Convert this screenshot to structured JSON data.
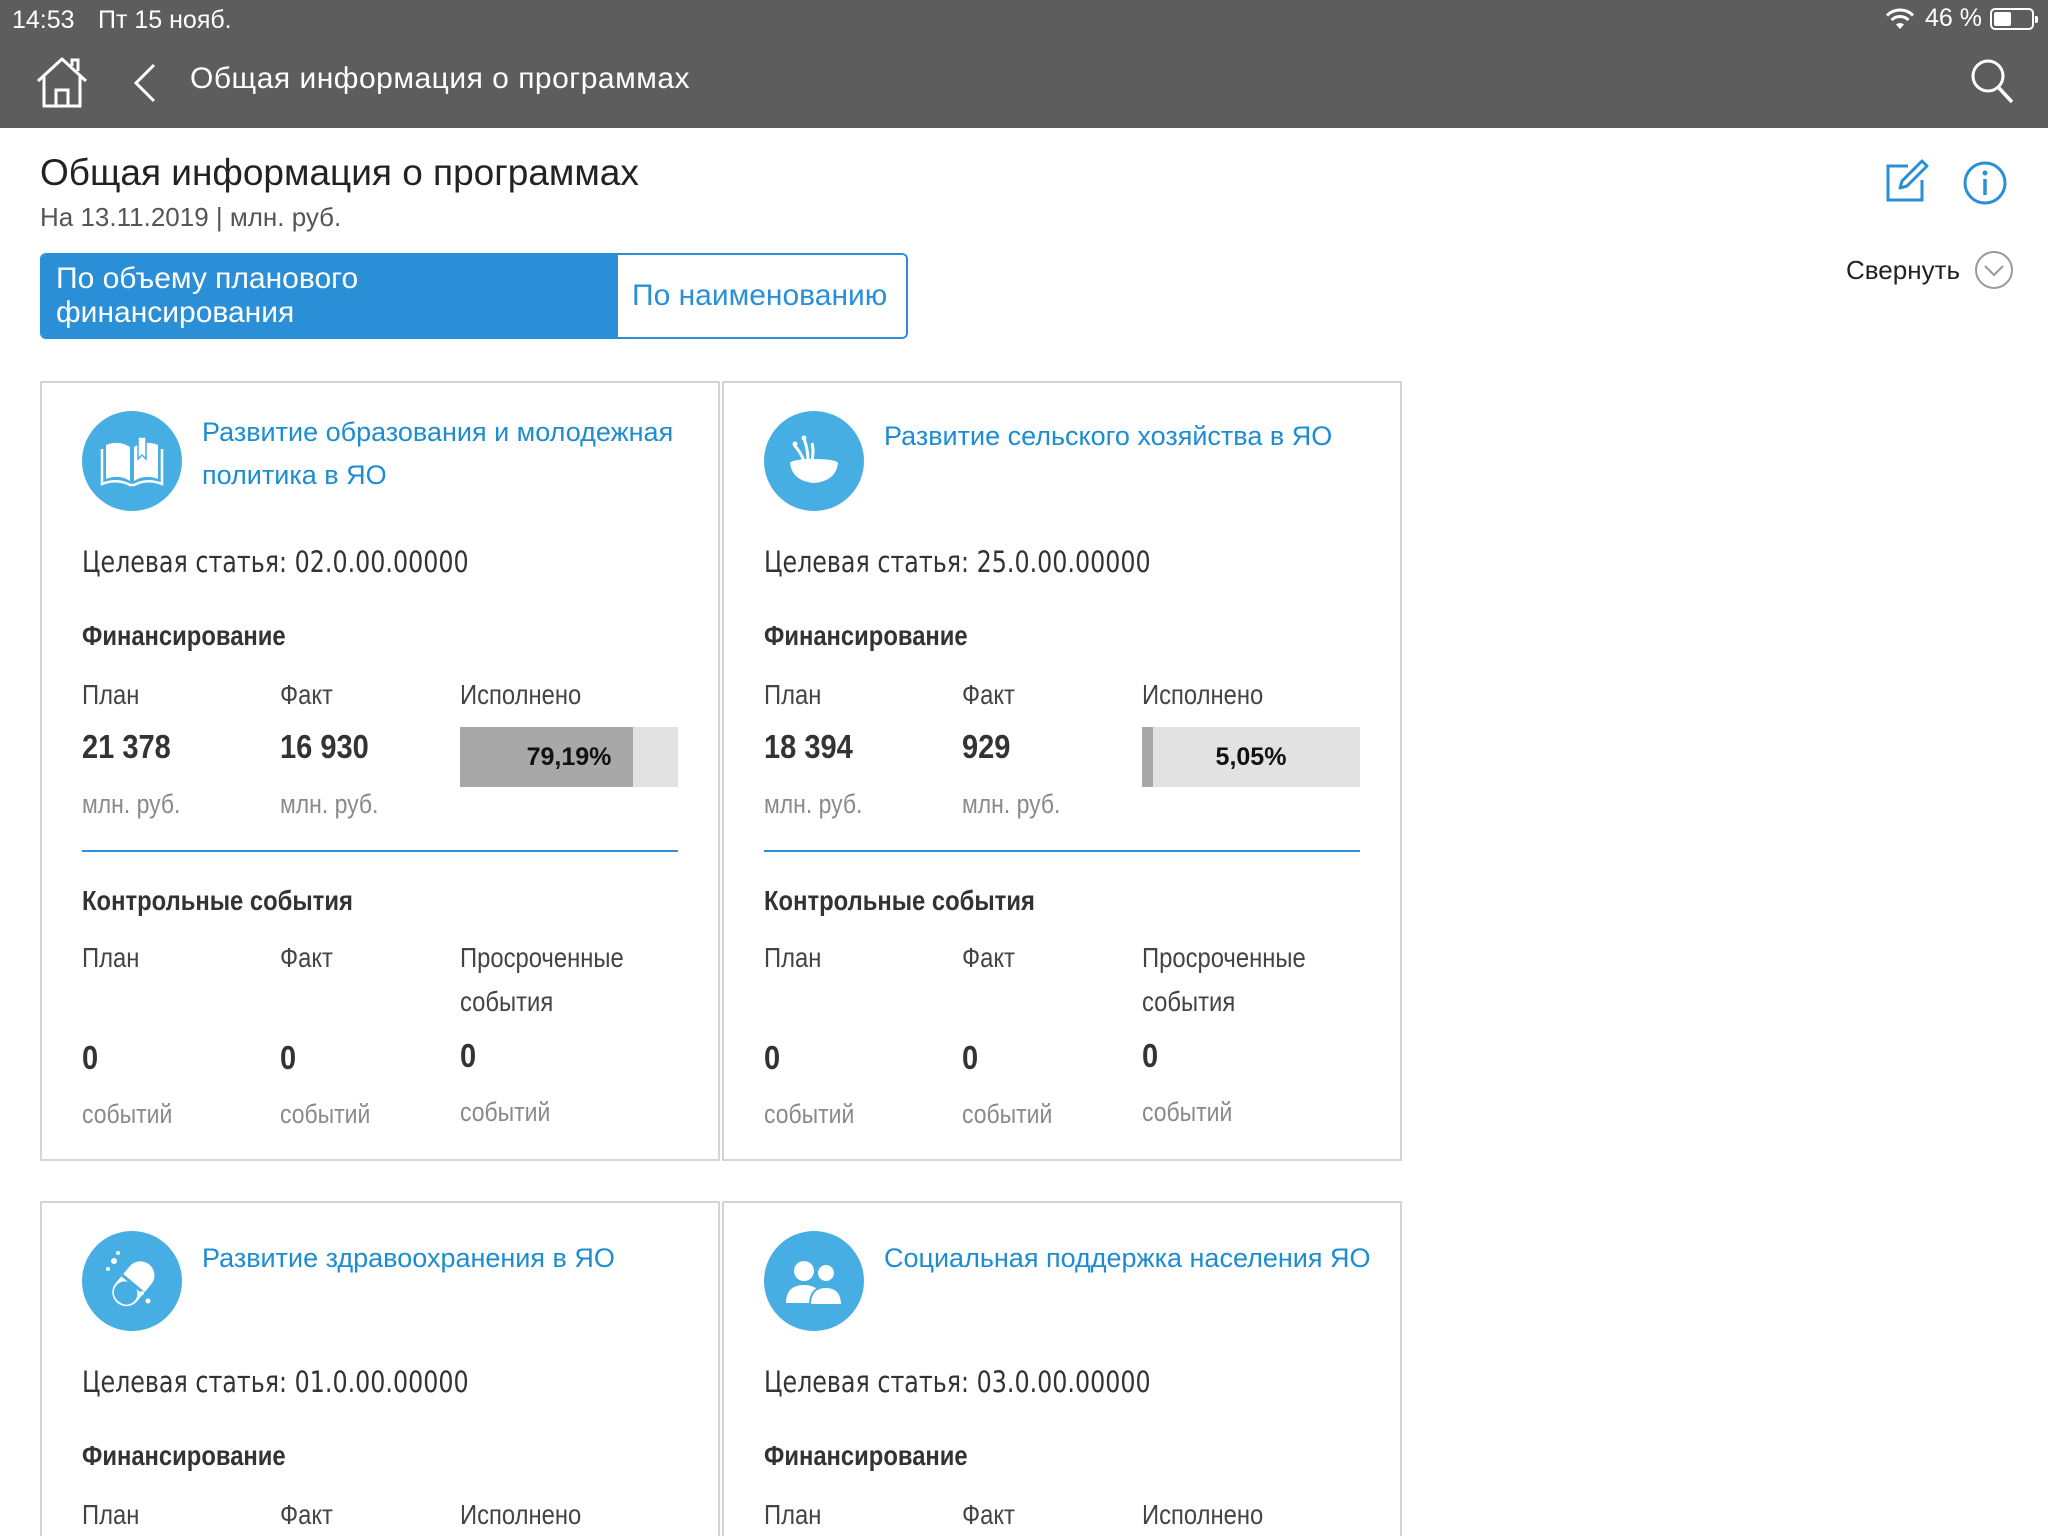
{
  "status_bar": {
    "time": "14:53",
    "date": "Пт 15 нояб.",
    "battery": "46 %",
    "battery_level": 0.46
  },
  "nav": {
    "title": "Общая информация о программах",
    "home_icon": "home-icon",
    "back_icon": "chevron-left-icon",
    "search_icon": "search-icon"
  },
  "header": {
    "title": "Общая информация о программах",
    "subtitle": "На 13.11.2019 | млн. руб.",
    "collapse_label": "Свернуть",
    "edit_icon": "edit-icon",
    "info_icon": "info-icon"
  },
  "sort_tabs": {
    "by_volume": "По объему планового финансирования",
    "by_name": "По наименованию",
    "active": "by_volume"
  },
  "labels": {
    "target_prefix": "Целевая статья:",
    "financing": "Финансирование",
    "plan": "План",
    "fact": "Факт",
    "done": "Исполнено",
    "unit_money": "млн. руб.",
    "control_events": "Контрольные события",
    "overdue_line1": "Просроченные",
    "overdue_line2": "события",
    "unit_events": "событий"
  },
  "accent_color": "#2a8fd6",
  "icon_color": "#46aee3",
  "programs": [
    {
      "title": "Развитие образования и молодежная политика в ЯО",
      "icon": "book-icon",
      "target": "02.0.00.00000",
      "plan": "21 378",
      "fact": "16 930",
      "done_label": "79,19%",
      "done_value": 79.19,
      "events_plan": "0",
      "events_fact": "0",
      "events_overdue": "0"
    },
    {
      "title": "Развитие сельского хозяйства в ЯО",
      "icon": "bowl-icon",
      "target": "25.0.00.00000",
      "plan": "18 394",
      "fact": "929",
      "done_label": "5,05%",
      "done_value": 5.05,
      "events_plan": "0",
      "events_fact": "0",
      "events_overdue": "0"
    },
    {
      "title": "Развитие здравоохранения в ЯО",
      "icon": "pill-icon",
      "target": "01.0.00.00000"
    },
    {
      "title": "Социальная поддержка населения ЯО",
      "icon": "people-icon",
      "target": "03.0.00.00000"
    }
  ]
}
